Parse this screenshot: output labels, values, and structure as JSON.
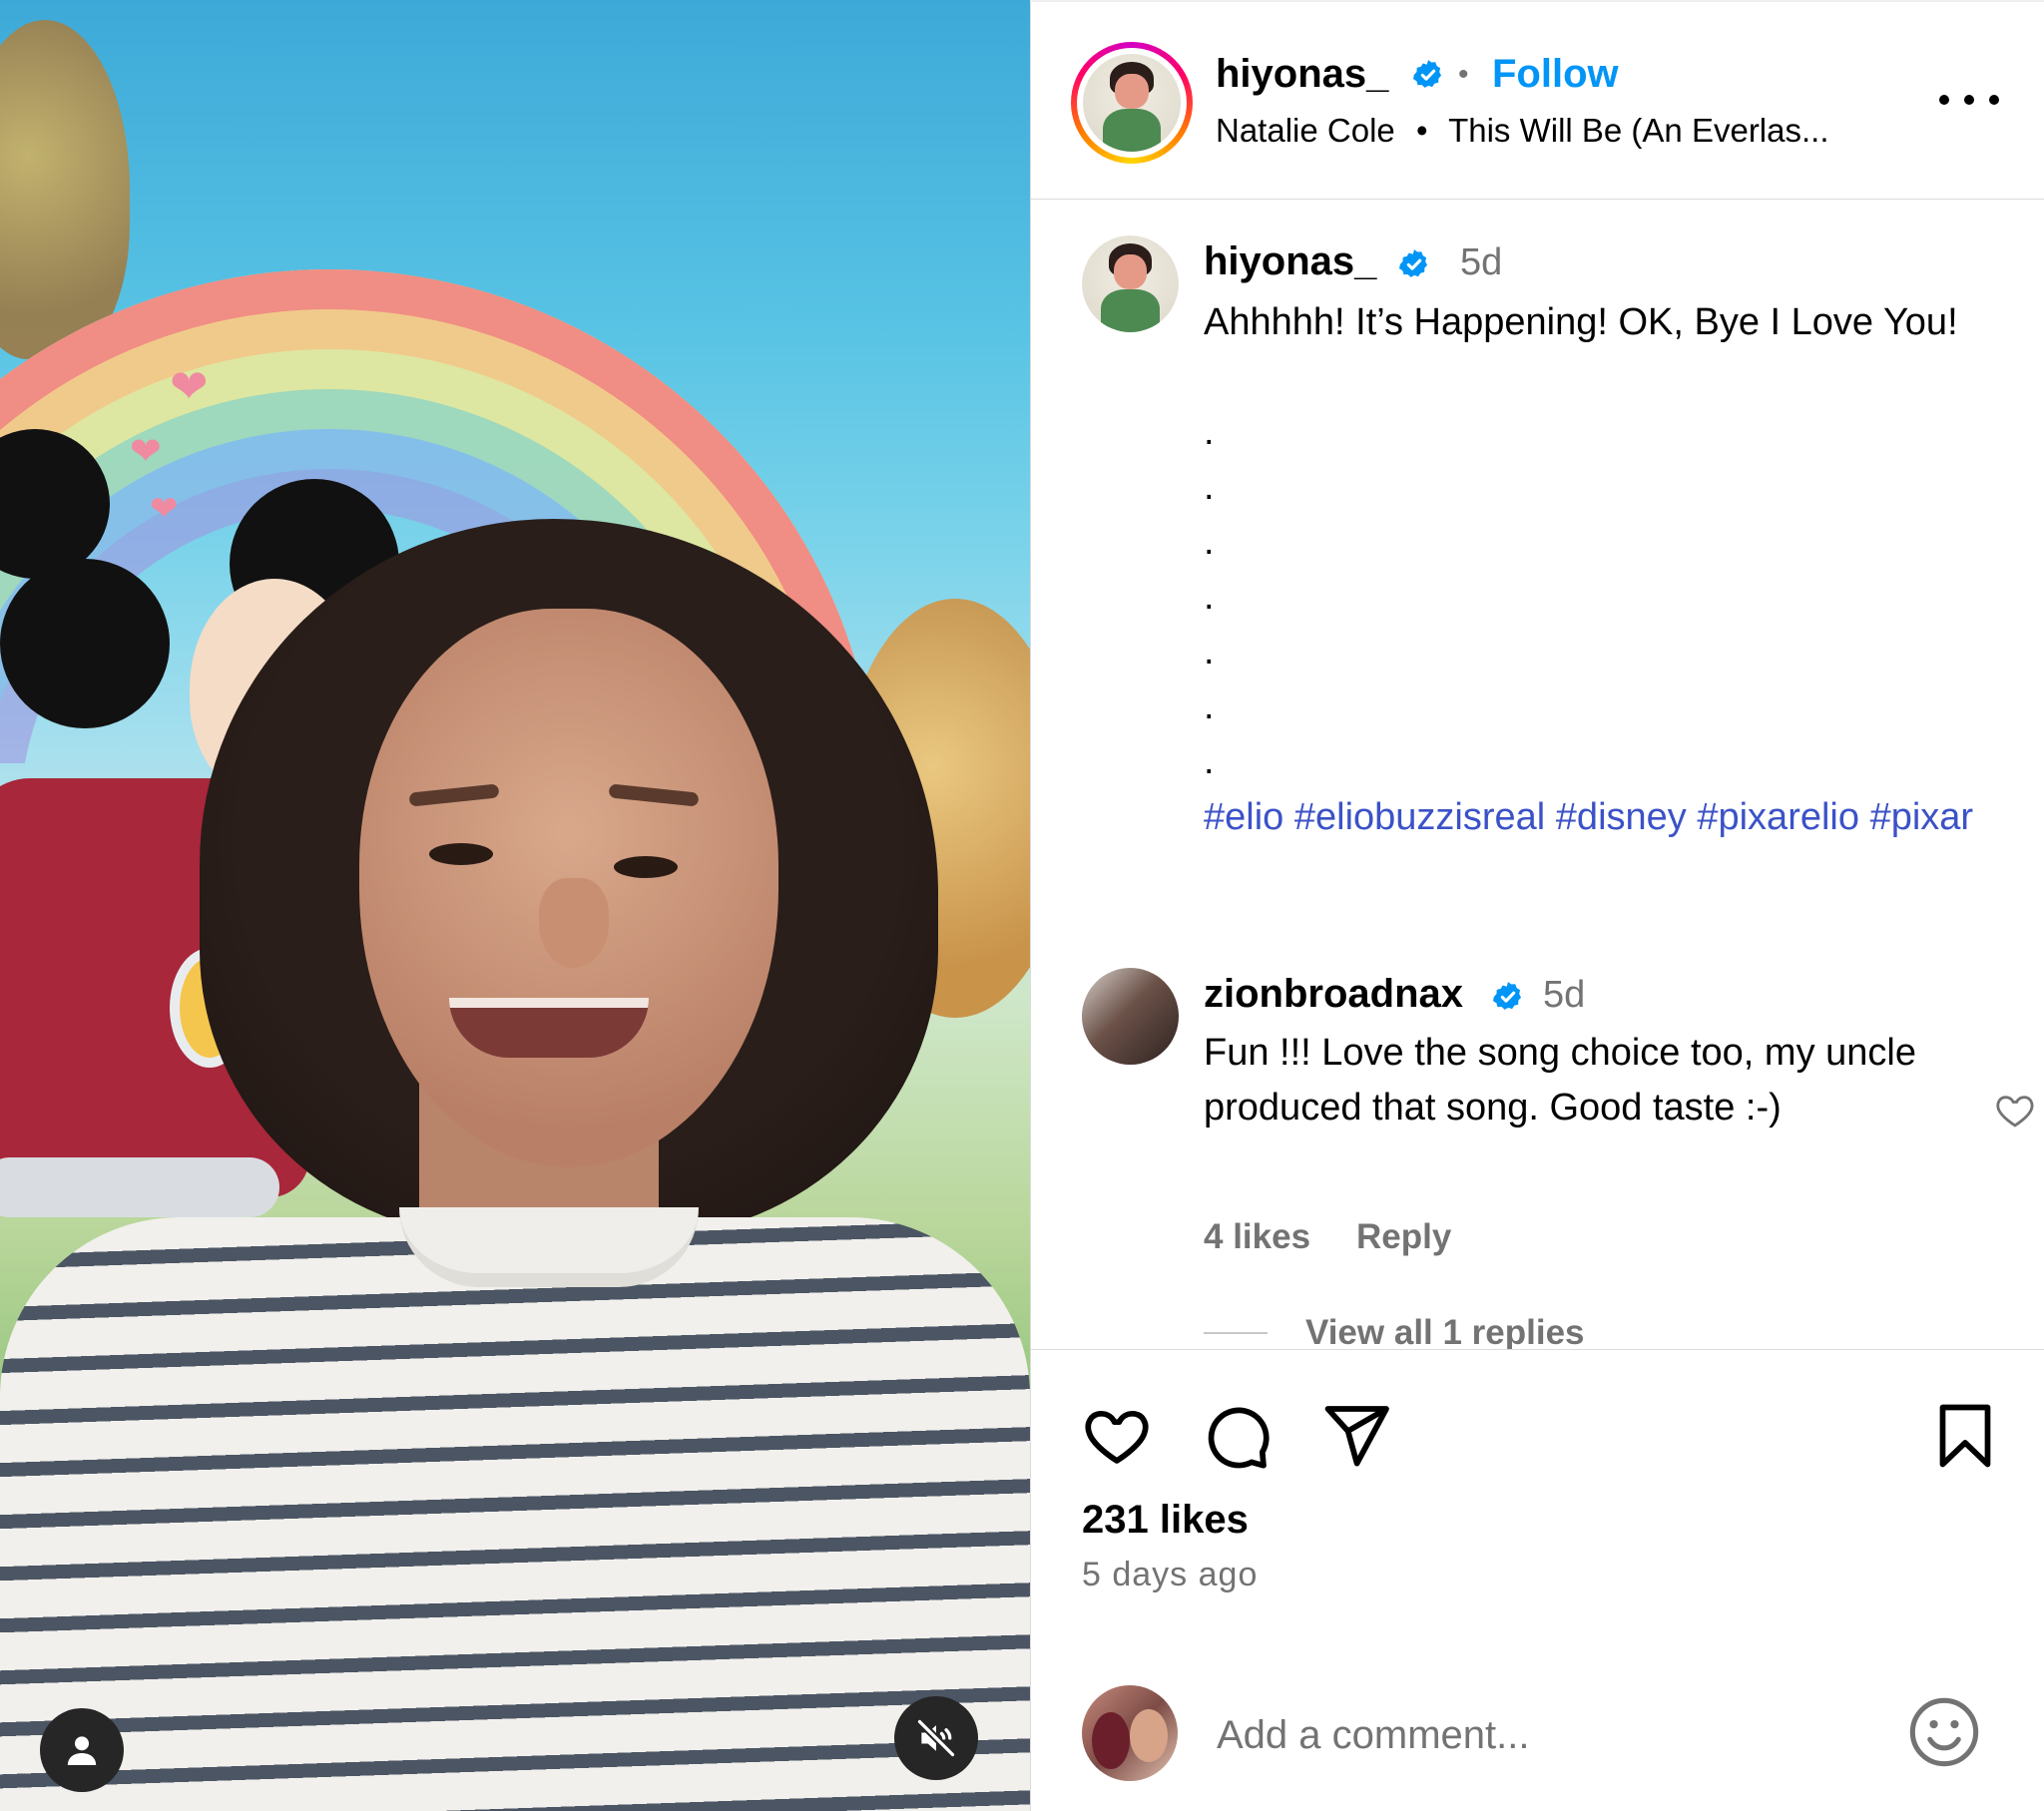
{
  "post": {
    "author": {
      "username": "hiyonas_",
      "verified": true,
      "follow_label": "Follow",
      "audio_artist": "Natalie Cole",
      "audio_separator": "•",
      "audio_title": "This Will Be (An Everlas..."
    },
    "more_icon": "more-horizontal-icon",
    "media": {
      "user_tag_icon": "user-icon",
      "mute_icon": "sound-off-icon"
    }
  },
  "comments": {
    "caption": {
      "username": "hiyonas_",
      "time": "5d",
      "text": "Ahhhhh! It’s Happening! OK, Bye I Love You!",
      "dots": [
        ".",
        ".",
        ".",
        ".",
        ".",
        ".",
        "."
      ],
      "hashtags": [
        "#elio",
        "#eliobuzzisreal",
        "#disney",
        "#pixarelio",
        "#pixar"
      ]
    },
    "items": [
      {
        "username": "zionbroadnax",
        "verified": true,
        "time": "5d",
        "text": "Fun !!! Love the song choice too, my uncle produced that song. Good taste :-)",
        "likes": "4 likes",
        "reply_label": "Reply",
        "view_replies": "View all 1 replies"
      }
    ]
  },
  "actions": {
    "like_icon": "heart-icon",
    "comment_icon": "comment-icon",
    "share_icon": "share-icon",
    "save_icon": "bookmark-icon",
    "likes": "231 likes",
    "time_ago": "5 days ago"
  },
  "add_comment": {
    "placeholder": "Add a comment...",
    "emoji_icon": "emoji-icon"
  },
  "colors": {
    "link_blue": "#0095f6",
    "hashtag": "#3b52c7",
    "secondary_text": "#737373",
    "divider": "#dbdbdb"
  }
}
